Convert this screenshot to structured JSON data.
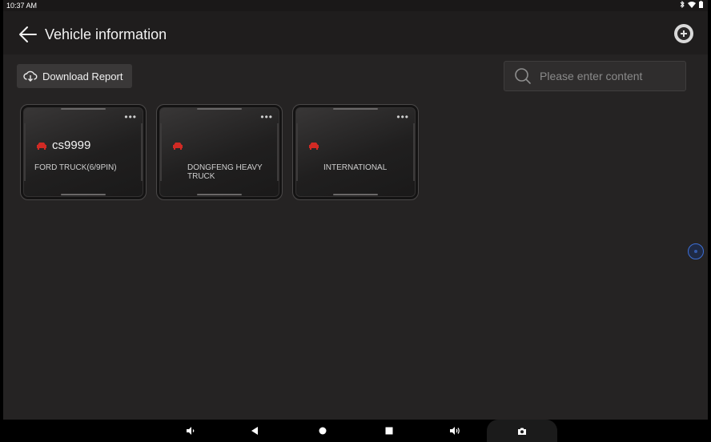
{
  "status_bar": {
    "time": "10:37 AM",
    "icons": [
      "bluetooth-icon",
      "wifi-icon",
      "battery-icon"
    ]
  },
  "header": {
    "title": "Vehicle information",
    "back_icon": "arrow-left-icon",
    "add_icon": "plus-circle-icon"
  },
  "toolbar": {
    "download_label": "Download Report",
    "download_icon": "cloud-download-icon",
    "search_placeholder": "Please enter content",
    "search_value": ""
  },
  "vehicles": [
    {
      "plate": "cs9999",
      "model": "FORD TRUCK(6/9PIN)",
      "more": "•••"
    },
    {
      "plate": "",
      "model": "DONGFENG HEAVY TRUCK",
      "more": "•••"
    },
    {
      "plate": "",
      "model": "INTERNATIONAL",
      "more": "•••"
    }
  ],
  "nav_bar": {
    "items": [
      "volume-down-icon",
      "back-triangle-icon",
      "home-circle-icon",
      "recents-square-icon",
      "volume-up-icon",
      "camera-icon"
    ]
  },
  "colors": {
    "background": "#252323",
    "header": "#1f1d1d",
    "car_icon": "#d12a24",
    "assist_ring": "#3d6fd6"
  }
}
